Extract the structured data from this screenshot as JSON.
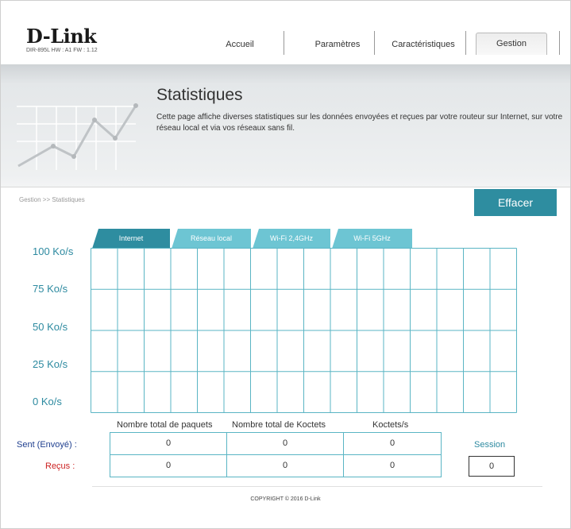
{
  "header": {
    "logo": "D-Link",
    "device_info": "DIR-895L   HW : A1   FW : 1.12",
    "nav": [
      {
        "label": "Accueil"
      },
      {
        "label": "Paramètres"
      },
      {
        "label": "Caractéristiques"
      },
      {
        "label": "Gestion"
      }
    ]
  },
  "banner": {
    "title": "Statistiques",
    "description": "Cette page affiche diverses statistiques sur les données envoyées et reçues par votre routeur sur Internet, sur votre réseau local et via vos réseaux sans fil."
  },
  "breadcrumb": "Gestion >> Statistiques",
  "clear_button": "Effacer",
  "tabs": [
    {
      "label": "Internet"
    },
    {
      "label": "Réseau local"
    },
    {
      "label": "Wi-Fi 2,4GHz"
    },
    {
      "label": "Wi-Fi 5GHz"
    }
  ],
  "chart_data": {
    "type": "line",
    "y_tick_labels": [
      "100 Ko/s",
      "75 Ko/s",
      "50 Ko/s",
      "25 Ko/s",
      "0 Ko/s"
    ],
    "ylim": [
      0,
      100
    ],
    "grid": true,
    "series": []
  },
  "stats": {
    "columns": [
      "Nombre total de paquets",
      "Nombre total de Koctets",
      "Koctets/s"
    ],
    "rows": [
      {
        "label": "Sent (Envoyé) :",
        "values": [
          "0",
          "0",
          "0"
        ]
      },
      {
        "label": "Reçus :",
        "values": [
          "0",
          "0",
          "0"
        ]
      }
    ],
    "session_label": "Session",
    "session_value": "0"
  },
  "colors": {
    "accent": "#2e8da0",
    "tab_inactive": "#6dc5d3",
    "sent_label": "#1f3f8f",
    "received_label": "#cc2222"
  },
  "copyright": "COPYRIGHT © 2016 D-Link"
}
